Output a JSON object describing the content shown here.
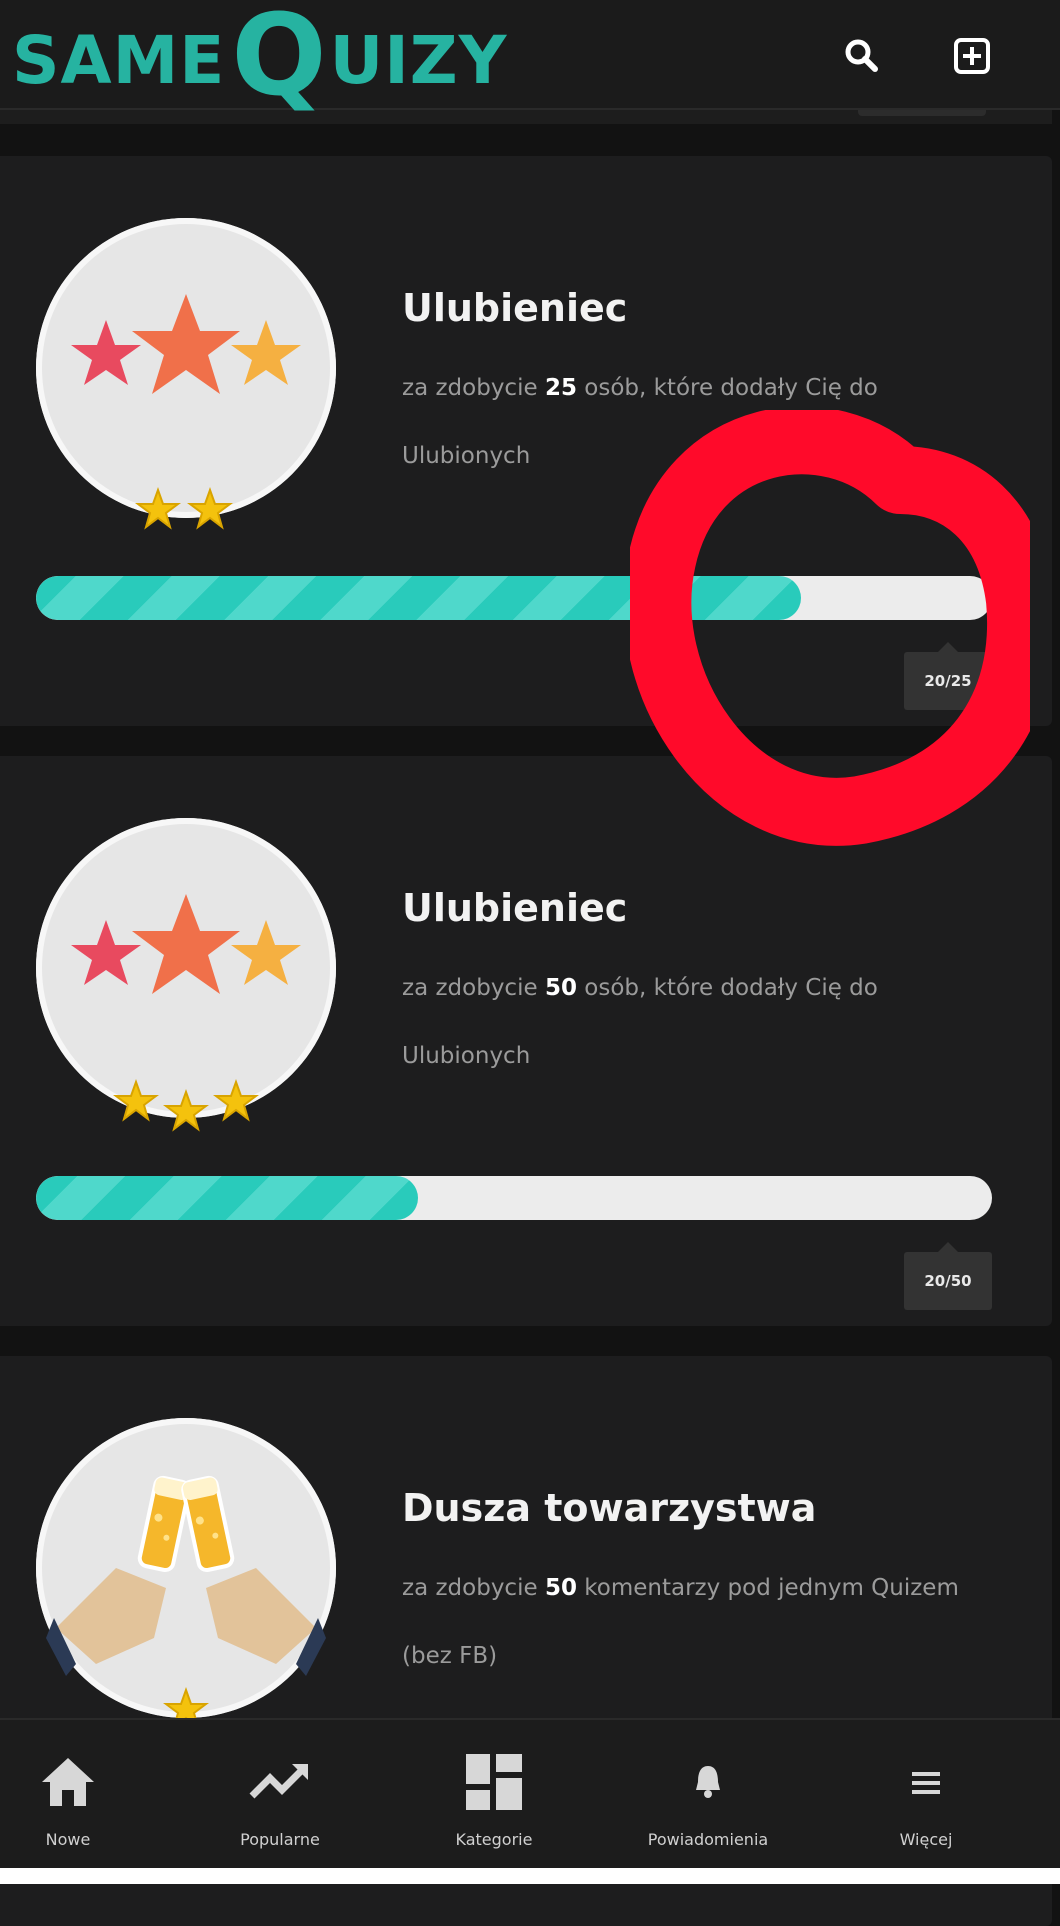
{
  "header": {
    "logo_prefix": "SAME",
    "logo_big": "Q",
    "logo_suffix": "UIZY"
  },
  "badges": [
    {
      "title": "Ulubieniec",
      "desc_before": "za zdobycie ",
      "desc_number": "25",
      "desc_after": " osób, które dodały Cię do Ulubionych",
      "progress_fraction": 0.8,
      "counter": "20/25"
    },
    {
      "title": "Ulubieniec",
      "desc_before": "za zdobycie ",
      "desc_number": "50",
      "desc_after": " osób, które dodały Cię do Ulubionych",
      "progress_fraction": 0.4,
      "counter": "20/50"
    },
    {
      "title": "Dusza towarzystwa",
      "desc_before": "za zdobycie ",
      "desc_number": "50",
      "desc_after": " komentarzy pod jednym Quizem (bez FB)"
    }
  ],
  "nav": [
    {
      "label": "Nowe",
      "icon": "home-icon"
    },
    {
      "label": "Popularne",
      "icon": "trending-icon"
    },
    {
      "label": "Kategorie",
      "icon": "categories-icon"
    },
    {
      "label": "Powiadomienia",
      "icon": "bell-icon"
    },
    {
      "label": "Więcej",
      "icon": "menu-icon"
    }
  ],
  "colors": {
    "accent": "#26b3a1",
    "annotation": "#ff0a2a",
    "progress": "#29cbbb",
    "background": "#121212",
    "card": "#1d1d1e"
  }
}
